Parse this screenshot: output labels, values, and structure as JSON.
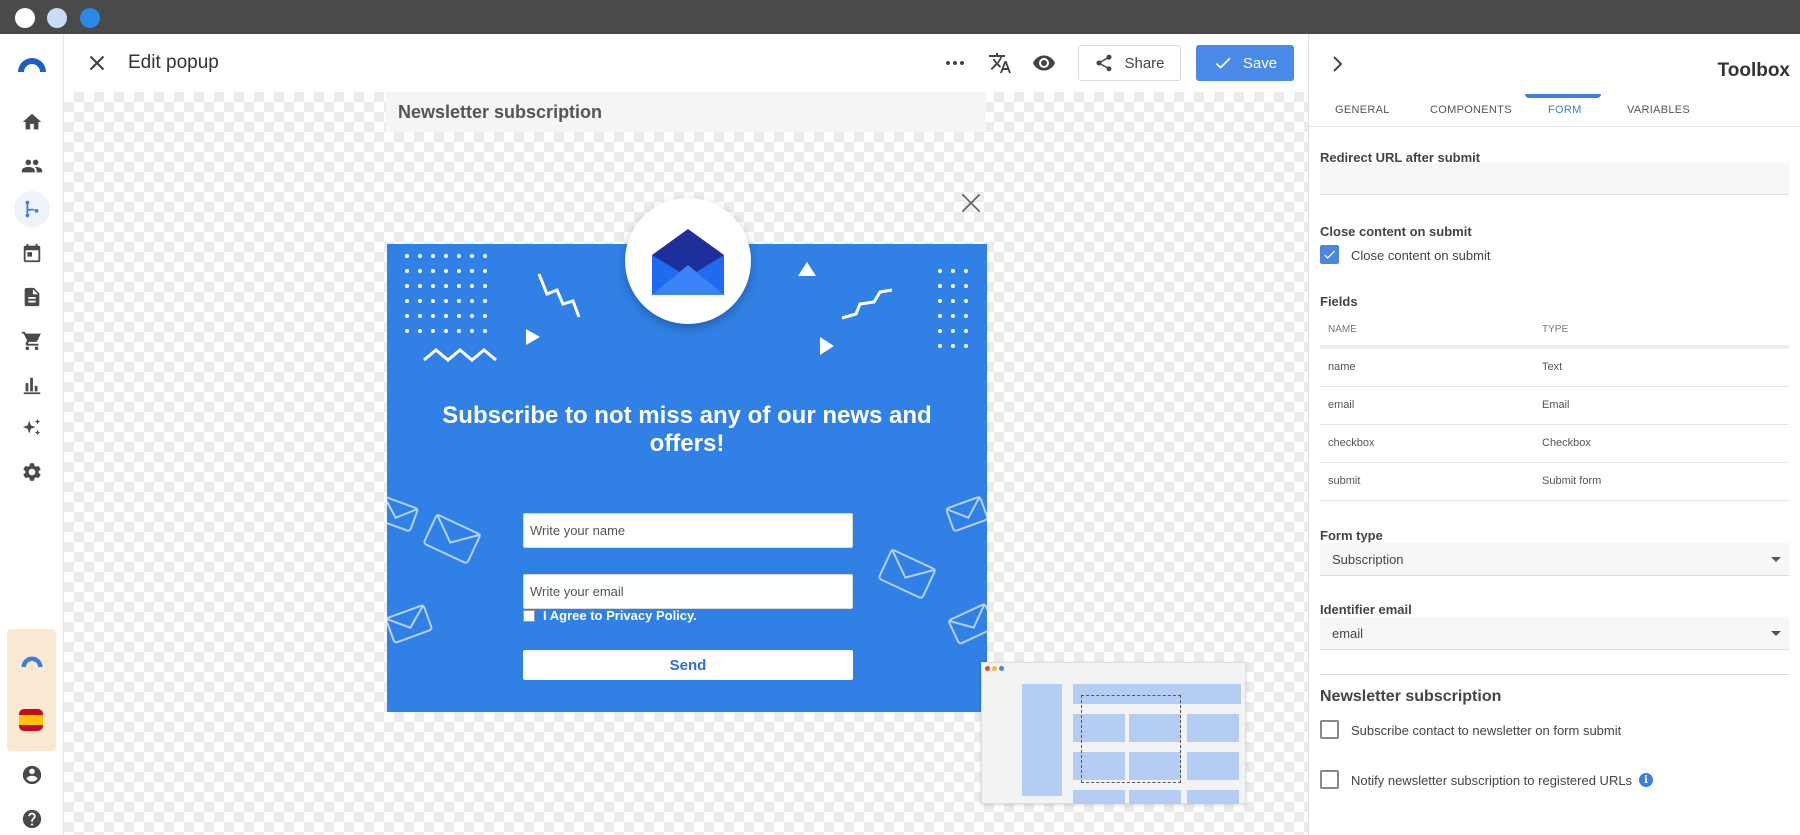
{
  "window": {
    "dots": [
      "#ffffff",
      "#c8dcf5",
      "#2a88e8"
    ]
  },
  "header": {
    "title": "Edit popup",
    "share_label": "Share",
    "save_label": "Save"
  },
  "canvas": {
    "label": "Newsletter subscription",
    "popup": {
      "heading": "Subscribe to not miss any of our news and offers!",
      "name_placeholder": "Write your name",
      "email_placeholder": "Write your email",
      "agree_label": "I Agree to Privacy Policy.",
      "send_label": "Send"
    }
  },
  "panel": {
    "title": "Toolbox",
    "tabs": [
      {
        "label": "GENERAL"
      },
      {
        "label": "COMPONENTS"
      },
      {
        "label": "FORM",
        "active": true
      },
      {
        "label": "VARIABLES"
      }
    ],
    "redirect_label": "Redirect URL after submit",
    "redirect_value": "",
    "close_content_label": "Close content on submit",
    "close_content_checkbox": "Close content on submit",
    "close_content_checked": true,
    "fields_label": "Fields",
    "fields_columns": [
      "NAME",
      "TYPE"
    ],
    "fields_rows": [
      {
        "name": "name",
        "type": "Text"
      },
      {
        "name": "email",
        "type": "Email"
      },
      {
        "name": "checkbox",
        "type": "Checkbox"
      },
      {
        "name": "submit",
        "type": "Submit form"
      }
    ],
    "form_type_label": "Form type",
    "form_type_value": "Subscription",
    "identifier_label": "Identifier email",
    "identifier_value": "email",
    "newsletter_title": "Newsletter subscription",
    "subscribe_label": "Subscribe contact to newsletter on form submit",
    "subscribe_checked": false,
    "notify_label": "Notify newsletter subscription to registered URLs",
    "notify_checked": false
  },
  "colors": {
    "accent": "#3b7de0",
    "save_button": "#4a8ae8",
    "popup_background": "#3080e6",
    "promo_background": "#fbe9d4"
  },
  "icons": {
    "rail": [
      "home-icon",
      "people-icon",
      "flow-icon",
      "calendar-icon",
      "document-icon",
      "cart-icon",
      "chart-icon",
      "sparkle-icon",
      "gear-icon"
    ],
    "header": [
      "close-icon",
      "more-icon",
      "translate-icon",
      "eye-icon",
      "share-icon",
      "check-icon"
    ]
  }
}
